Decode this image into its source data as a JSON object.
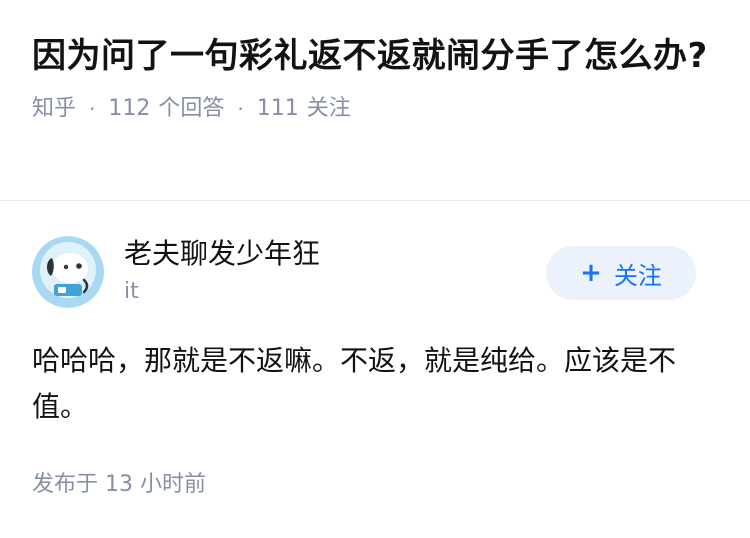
{
  "question": {
    "title": "因为问了一句彩礼返不返就闹分手了怎么办?",
    "source": "知乎",
    "answer_count": "112",
    "answer_label": "个回答",
    "follower_count": "111",
    "follower_label": "关注"
  },
  "author": {
    "name": "老夫聊发少年狂",
    "bio": "it",
    "avatar_icon": "robot-dog-avatar-icon",
    "follow": {
      "icon": "plus-icon",
      "label": "关注"
    }
  },
  "answer": {
    "content": "哈哈哈，那就是不返嘛。不返，就是纯给。应该是不值。",
    "time": "发布于 13 小时前"
  },
  "colors": {
    "text_primary": "#121212",
    "text_secondary": "#8590a6",
    "accent": "#1772f6",
    "accent_bg": "#ebf2fc"
  }
}
